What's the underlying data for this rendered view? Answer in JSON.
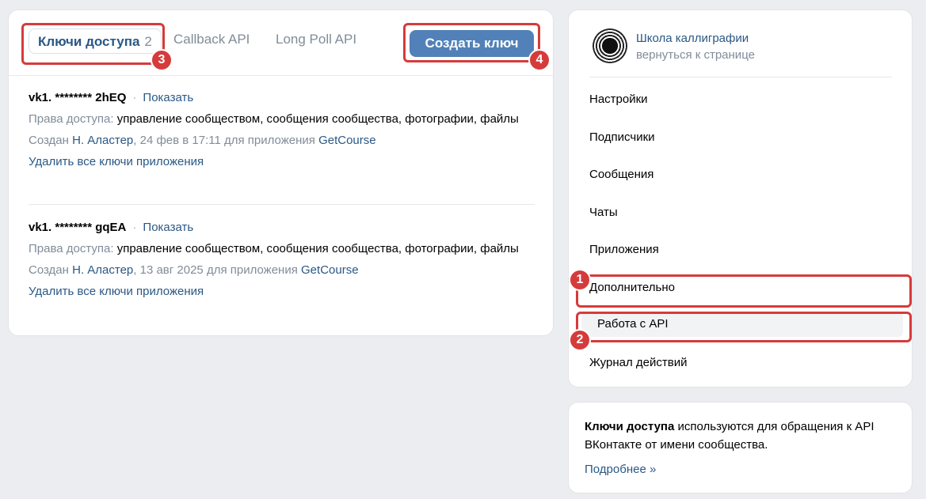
{
  "tabs": [
    {
      "label": "Ключи доступа",
      "count": "2"
    },
    {
      "label": "Callback API"
    },
    {
      "label": "Long Poll API"
    }
  ],
  "create_button": "Создать ключ",
  "keys": [
    {
      "name": "vk1. ******** 2hEQ",
      "show": "Показать",
      "rights_label": "Права доступа:",
      "rights": "управление сообществом, сообщения сообщества, фотографии, файлы",
      "created_prefix": "Создан",
      "author": "Н. Аластер",
      "created_date": ", 24 фев в 17:11 для приложения",
      "app": "GetCourse",
      "delete": "Удалить все ключи приложения"
    },
    {
      "name": "vk1. ******** gqEA",
      "show": "Показать",
      "rights_label": "Права доступа:",
      "rights": "управление сообществом, сообщения сообщества, фотографии, файлы",
      "created_prefix": "Создан",
      "author": "Н. Аластер",
      "created_date": ", 13 авг 2025 для приложения",
      "app": "GetCourse",
      "delete": "Удалить все ключи приложения"
    }
  ],
  "group": {
    "name": "Школа каллиграфии",
    "back": "вернуться к странице"
  },
  "menu": [
    "Настройки",
    "Подписчики",
    "Сообщения",
    "Чаты",
    "Приложения",
    "Дополнительно",
    "Работа с API",
    "Журнал действий"
  ],
  "info": {
    "bold": "Ключи доступа",
    "text": " используются для обращения к API ВКонтакте от имени сообщества.",
    "more": "Подробнее »"
  },
  "badges": [
    "1",
    "2",
    "3",
    "4"
  ],
  "colors": {
    "accent": "#5181b8",
    "link": "#2a5885",
    "highlight": "#d63b3b"
  }
}
